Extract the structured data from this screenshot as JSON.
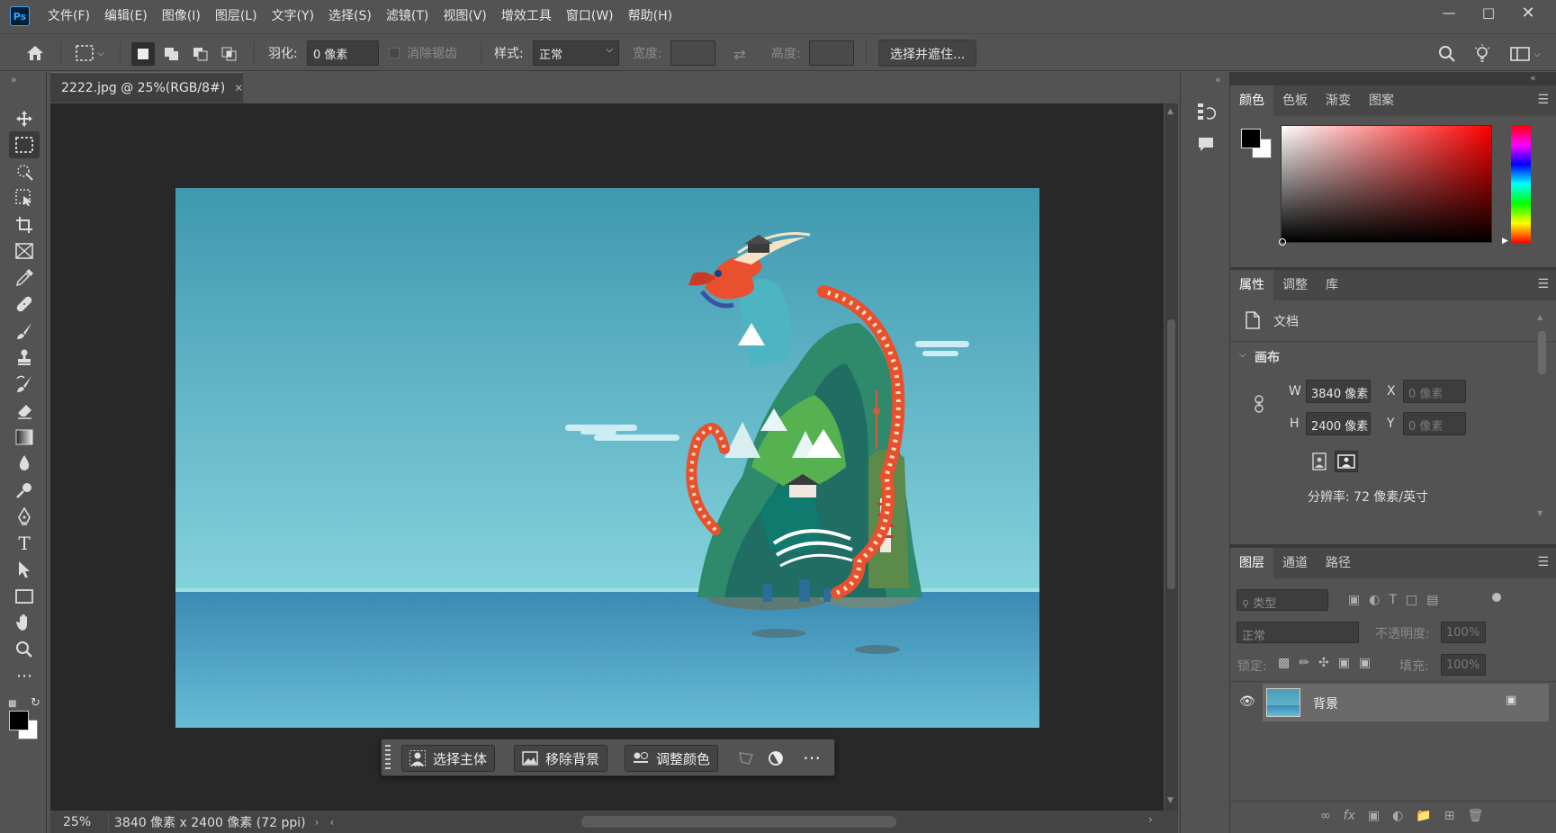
{
  "menubar": {
    "app_logo": "Ps",
    "items": [
      "文件(F)",
      "编辑(E)",
      "图像(I)",
      "图层(L)",
      "文字(Y)",
      "选择(S)",
      "滤镜(T)",
      "视图(V)",
      "增效工具",
      "窗口(W)",
      "帮助(H)"
    ]
  },
  "options": {
    "feather_label": "羽化:",
    "feather_value": "0 像素",
    "antialias_label": "消除锯齿",
    "style_label": "样式:",
    "style_value": "正常",
    "width_label": "宽度:",
    "height_label": "高度:",
    "select_mask_button": "选择并遮住..."
  },
  "document": {
    "tab_title": "2222.jpg @ 25%(RGB/8#)",
    "zoom": "25%",
    "size_info": "3840 像素 x 2400 像素 (72 ppi)"
  },
  "context_bar": {
    "select_subject": "选择主体",
    "remove_bg": "移除背景",
    "adjust_color": "调整颜色"
  },
  "color_panel": {
    "tabs": [
      "颜色",
      "色板",
      "渐变",
      "图案"
    ],
    "foreground": "#000000",
    "background": "#ffffff",
    "hue_base": "#ff0000"
  },
  "properties_panel": {
    "tabs": [
      "属性",
      "调整",
      "库"
    ],
    "doc_label": "文档",
    "canvas_section": "画布",
    "w_label": "W",
    "w_value": "3840 像素",
    "h_label": "H",
    "h_value": "2400 像素",
    "x_label": "X",
    "x_value": "0 像素",
    "y_label": "Y",
    "y_value": "0 像素",
    "resolution": "分辨率: 72 像素/英寸"
  },
  "layers_panel": {
    "tabs": [
      "图层",
      "通道",
      "路径"
    ],
    "filter_placeholder": "类型",
    "blend_mode": "正常",
    "opacity_label": "不透明度:",
    "opacity_value": "100%",
    "lock_label": "锁定:",
    "fill_label": "填充:",
    "fill_value": "100%",
    "layer_name": "背景"
  }
}
